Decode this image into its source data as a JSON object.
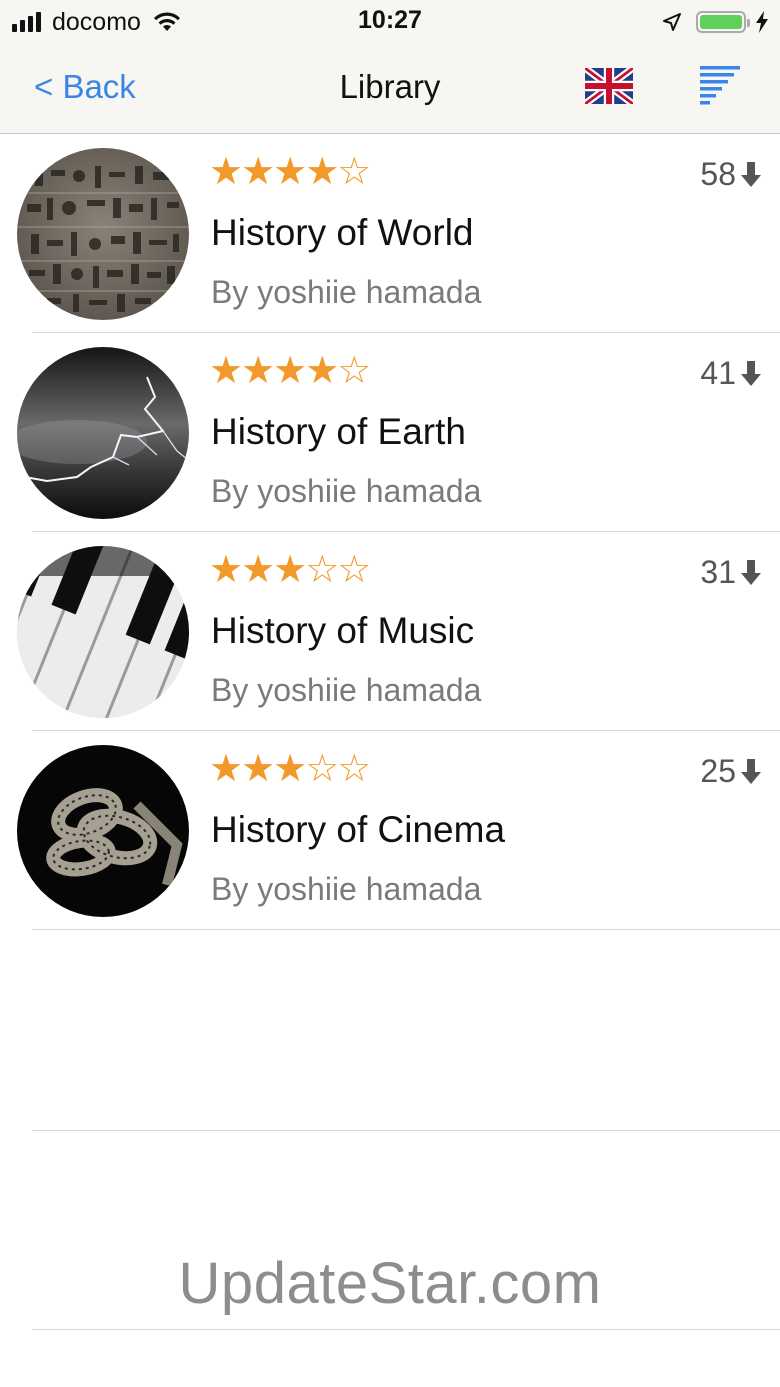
{
  "status_bar": {
    "carrier": "docomo",
    "time": "10:27",
    "battery_level": 1.0
  },
  "nav": {
    "back_label": "< Back",
    "title": "Library",
    "flag_icon": "uk-flag-icon",
    "sort_icon": "sort-lines-icon"
  },
  "colors": {
    "accent": "#3a86e6",
    "star": "#f19a2b",
    "battery": "#5fd05a"
  },
  "books": [
    {
      "title": "History of World",
      "author": "By yoshiie hamada",
      "rating": 4,
      "rating_display": "★★★★☆",
      "downloads": "58",
      "image": "hieroglyph-image"
    },
    {
      "title": "History of Earth",
      "author": "By yoshiie hamada",
      "rating": 4,
      "rating_display": "★★★★☆",
      "downloads": "41",
      "image": "lightning-image"
    },
    {
      "title": "History of Music",
      "author": "By yoshiie hamada",
      "rating": 3,
      "rating_display": "★★★☆☆",
      "downloads": "31",
      "image": "piano-keys-image"
    },
    {
      "title": "History of Cinema",
      "author": "By yoshiie hamada",
      "rating": 3,
      "rating_display": "★★★☆☆",
      "downloads": "25",
      "image": "film-reel-image"
    }
  ],
  "watermark": "UpdateStar.com"
}
